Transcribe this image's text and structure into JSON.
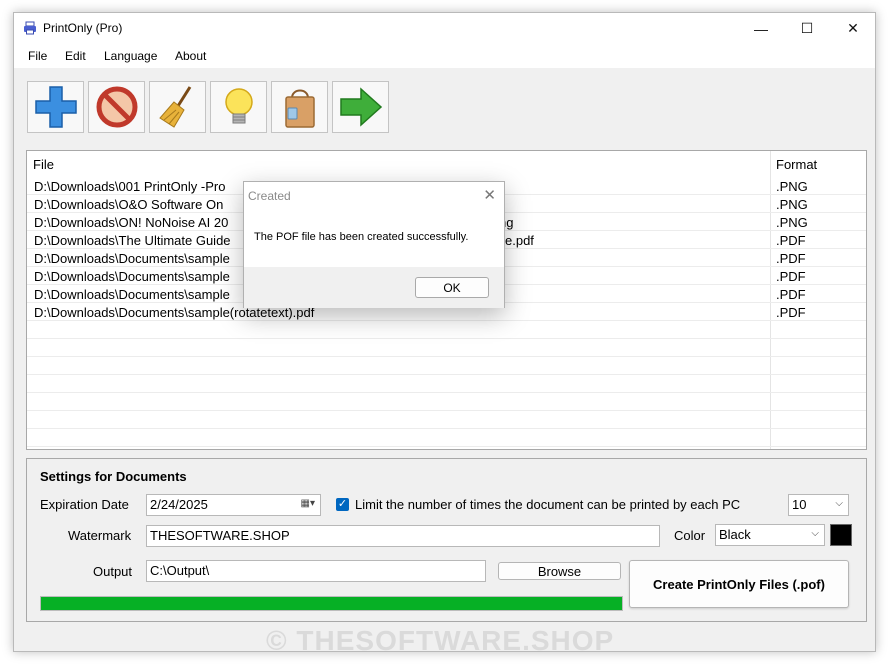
{
  "window": {
    "title": "PrintOnly (Pro)",
    "controls": {
      "minimize": "—",
      "maximize": "☐",
      "close": "✕"
    }
  },
  "menu": [
    "File",
    "Edit",
    "Language",
    "About"
  ],
  "toolbar": {
    "buttons": [
      {
        "icon": "add-icon"
      },
      {
        "icon": "prohibited-icon"
      },
      {
        "icon": "broom-icon"
      },
      {
        "icon": "lightbulb-icon"
      },
      {
        "icon": "shopping-bag-icon"
      },
      {
        "icon": "arrow-right-icon"
      }
    ]
  },
  "files": {
    "headers": {
      "file": "File",
      "format": "Format"
    },
    "rows": [
      {
        "file": "D:\\Downloads\\001 PrintOnly -Pro",
        "format": ".PNG"
      },
      {
        "file": "D:\\Downloads\\O&O Software On",
        "format": ".PNG"
      },
      {
        "file": "D:\\Downloads\\ON! NoNoise AI 20",
        "format": ".PNG"
      },
      {
        "file": "D:\\Downloads\\The Ultimate Guide",
        "format": ".PDF"
      },
      {
        "file": "D:\\Downloads\\Documents\\sample",
        "format": ".PDF"
      },
      {
        "file": "D:\\Downloads\\Documents\\sample",
        "format": ".PDF"
      },
      {
        "file": "D:\\Downloads\\Documents\\sample",
        "format": ".PDF"
      },
      {
        "file": "D:\\Downloads\\Documents\\sample(rotatetext).pdf",
        "format": ".PDF"
      }
    ],
    "row_fragments": [
      "ng",
      "e.pdf"
    ]
  },
  "settings": {
    "title": "Settings for Documents",
    "expiration_label": "Expiration Date",
    "expiration_value": "2/24/2025",
    "limit_checked": true,
    "limit_label": "Limit the number of times the document can be printed by each PC",
    "limit_value": "10",
    "watermark_label": "Watermark",
    "watermark_value": "THESOFTWARE.SHOP",
    "color_label": "Color",
    "color_value": "Black",
    "color_swatch": "#000000",
    "output_label": "Output",
    "output_value": "C:\\Output\\",
    "browse_label": "Browse",
    "create_label": "Create PrintOnly Files (.pof)",
    "progress": 1.0,
    "progress_color": "#06b025"
  },
  "dialog": {
    "title": "Created",
    "message": "The POF file has been created successfully.",
    "ok_label": "OK"
  },
  "watermark_overlay": "© THESOFTWARE.SHOP"
}
